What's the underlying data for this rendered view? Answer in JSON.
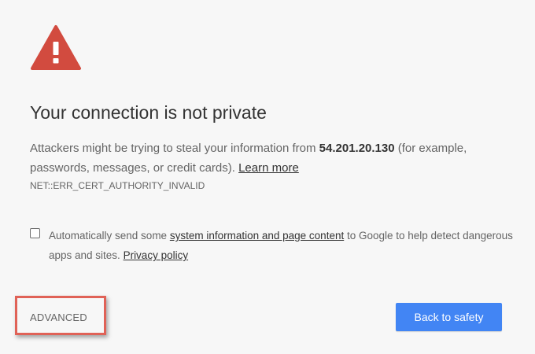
{
  "icon": "warning-triangle-icon",
  "colors": {
    "warning_red": "#d24b3f",
    "primary_blue": "#4285f4",
    "highlight_red": "#e06257",
    "background": "#f7f7f7"
  },
  "title": "Your connection is not private",
  "main_message": {
    "before_host": "Attackers might be trying to steal your information from ",
    "host": "54.201.20.130",
    "after_host": " (for example, passwords, messages, or credit cards). ",
    "learn_more": "Learn more"
  },
  "error_code": "NET::ERR_CERT_AUTHORITY_INVALID",
  "extended_reporting": {
    "checked": false,
    "before_link": "Automatically send some ",
    "link": "system information and page content",
    "after_link": " to Google to help detect dangerous apps and sites. ",
    "privacy_policy": "Privacy policy"
  },
  "buttons": {
    "advanced": "ADVANCED",
    "back_to_safety": "Back to safety"
  }
}
